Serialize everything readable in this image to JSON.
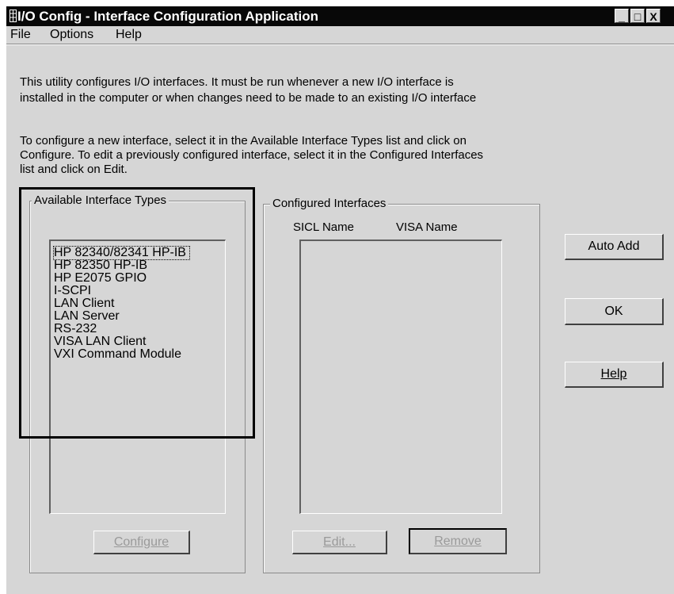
{
  "titlebar": {
    "title": "I/O Config -  Interface Configuration Application",
    "minimize": "_",
    "maximize": "□",
    "close": "X"
  },
  "menu": [
    "File",
    "Options",
    "Help"
  ],
  "description": {
    "line1": "This utility configures I/O interfaces.  It must be run whenever a new I/O interface is",
    "line2": "installed in the computer or when changes need to be made to an existing I/O interface",
    "line3": "To configure a new interface, select it in the Available Interface Types list and click on",
    "line4": "Configure.  To edit a previously configured interface, select it in the Configured Interfaces",
    "line5": "list and click on Edit."
  },
  "available": {
    "label": "Available Interface Types",
    "items": [
      "HP 82340/82341 HP-IB",
      "HP 82350 HP-IB",
      "HP E2075 GPIO",
      "I-SCPI",
      "LAN Client",
      "LAN Server",
      "RS-232",
      "VISA LAN Client",
      "VXI Command Module"
    ],
    "selected_index": 0,
    "configure_label": "Configure"
  },
  "configured": {
    "label": "Configured Interfaces",
    "col_sicl": "SICL Name",
    "col_visa": "VISA Name",
    "items": [],
    "edit_label": "Edit...",
    "remove_label": "Remove"
  },
  "side_buttons": {
    "auto_add": "Auto Add",
    "ok": "OK",
    "help": "Help"
  },
  "colors": {
    "dialog_bg": "#d6d6d6",
    "titlebar_bg": "#080808",
    "highlight_box": "#000000"
  }
}
